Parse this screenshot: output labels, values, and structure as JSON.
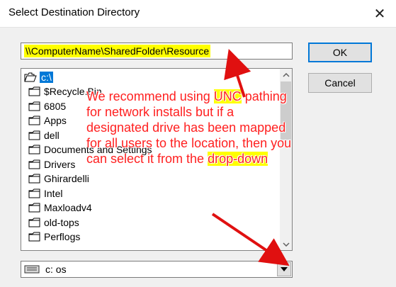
{
  "dialog": {
    "title": "Select Destination Directory",
    "close_glyph": "✕"
  },
  "path_input": {
    "value": "\\\\ComputerName\\SharedFolder\\Resource"
  },
  "buttons": {
    "ok": "OK",
    "cancel": "Cancel"
  },
  "directory_list": {
    "items": [
      {
        "label": "c:\\",
        "icon": "open-folder-icon",
        "selected": true
      },
      {
        "label": "$Recycle.Bin",
        "icon": "folder-icon"
      },
      {
        "label": "6805",
        "icon": "folder-icon"
      },
      {
        "label": "Apps",
        "icon": "folder-icon"
      },
      {
        "label": "dell",
        "icon": "folder-icon"
      },
      {
        "label": "Documents and Settings",
        "icon": "folder-icon"
      },
      {
        "label": "Drivers",
        "icon": "folder-icon"
      },
      {
        "label": "Ghirardelli",
        "icon": "folder-icon"
      },
      {
        "label": "Intel",
        "icon": "folder-icon"
      },
      {
        "label": "Maxloadv4",
        "icon": "folder-icon"
      },
      {
        "label": "old-tops",
        "icon": "folder-icon"
      },
      {
        "label": "Perflogs",
        "icon": "folder-icon"
      }
    ]
  },
  "drive_select": {
    "value": "c: os",
    "icon": "drive-icon"
  },
  "annotation": {
    "part1": "We recommend using ",
    "unc": "UNC",
    "part2": " pathing for network installs but if a designated drive has been mapped for all users to the location, then you can select it from the ",
    "dropdown": "drop-down",
    "color": "#ff2020",
    "highlight": "#ffff00"
  }
}
